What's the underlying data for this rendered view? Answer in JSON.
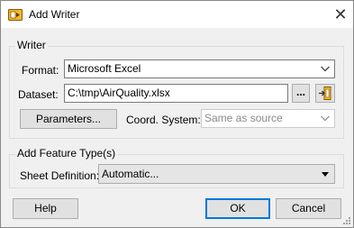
{
  "window": {
    "title": "Add Writer",
    "close_glyph": "✕"
  },
  "writer_group": {
    "title": "Writer",
    "format_label": "Format:",
    "format_value": "Microsoft Excel",
    "dataset_label": "Dataset:",
    "dataset_value": "C:\\tmp\\AirQuality.xlsx",
    "browse_label": "...",
    "parameters_label": "Parameters...",
    "coord_label": "Coord. System:",
    "coord_value": "Same as source"
  },
  "feature_group": {
    "title": "Add Feature Type(s)",
    "sheet_label": "Sheet Definition:",
    "sheet_value": "Automatic..."
  },
  "buttons": {
    "help": "Help",
    "ok": "OK",
    "cancel": "Cancel"
  },
  "icons": {
    "title": "fme-writer-icon",
    "browse_folder": "dataset-browse-icon",
    "close": "close-icon"
  },
  "colors": {
    "focus_border": "#0078d7",
    "disabled_text": "#8a8a8a"
  }
}
